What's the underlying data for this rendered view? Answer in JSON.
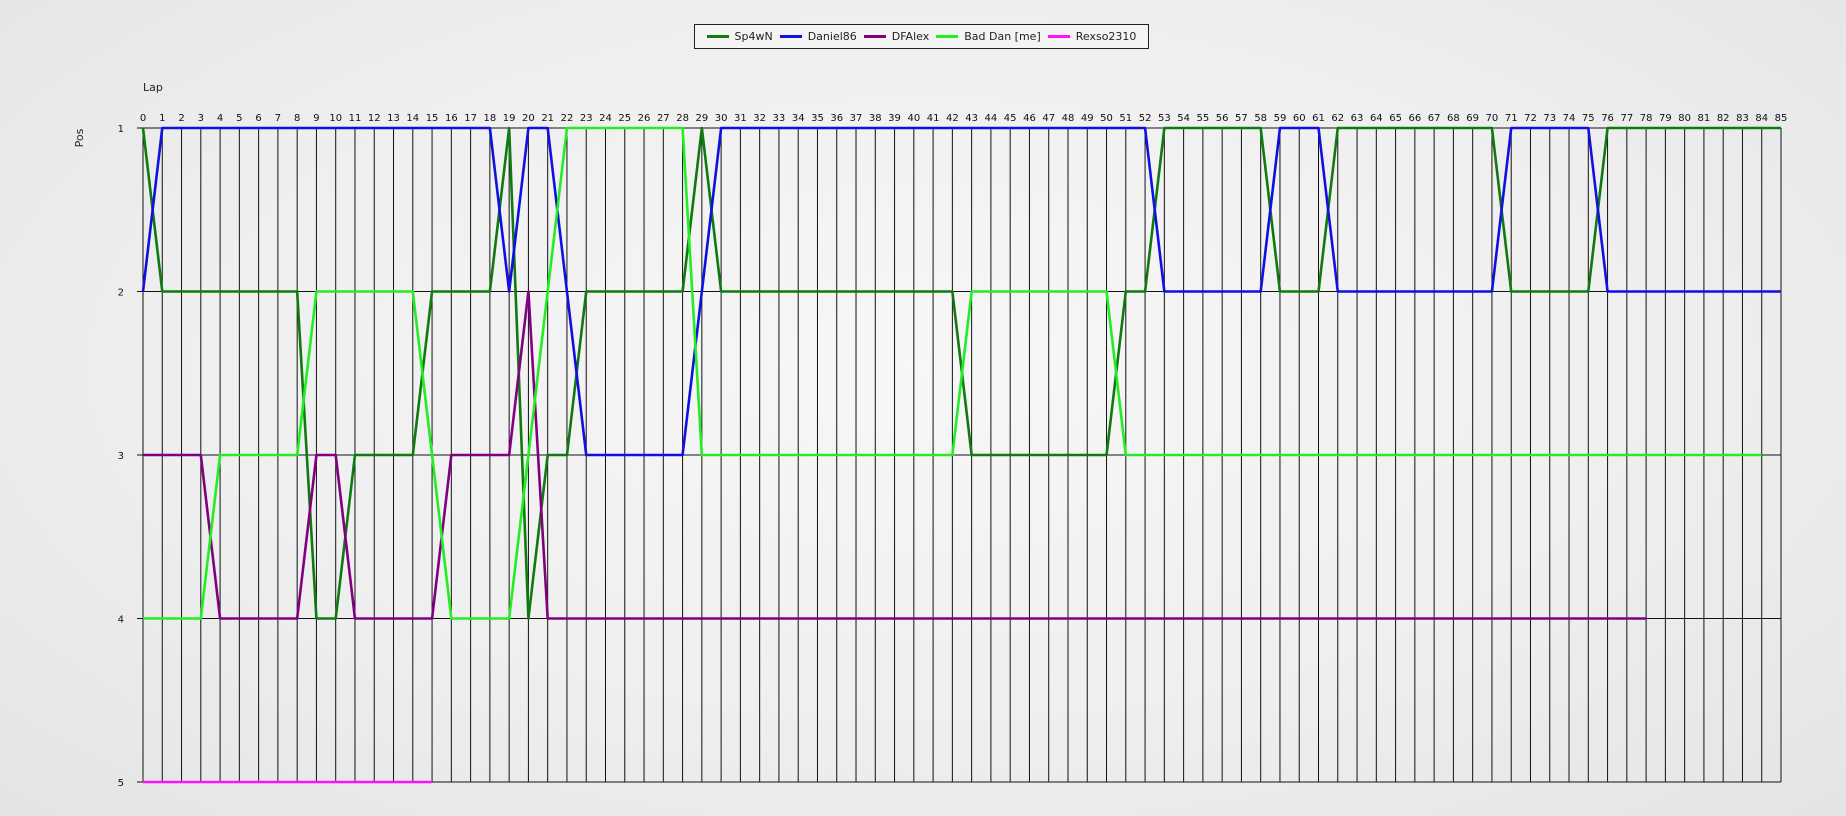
{
  "chart_data": {
    "type": "line",
    "xlabel": "Lap",
    "ylabel": "Pos",
    "xlim": [
      0,
      85
    ],
    "ylim": [
      1,
      5
    ],
    "y_inverted": true,
    "grid": true,
    "legend_position": "top-center",
    "x_ticks": [
      0,
      1,
      2,
      3,
      4,
      5,
      6,
      7,
      8,
      9,
      10,
      11,
      12,
      13,
      14,
      15,
      16,
      17,
      18,
      19,
      20,
      21,
      22,
      23,
      24,
      25,
      26,
      27,
      28,
      29,
      30,
      31,
      32,
      33,
      34,
      35,
      36,
      37,
      38,
      39,
      40,
      41,
      42,
      43,
      44,
      45,
      46,
      47,
      48,
      49,
      50,
      51,
      52,
      53,
      54,
      55,
      56,
      57,
      58,
      59,
      60,
      61,
      62,
      63,
      64,
      65,
      66,
      67,
      68,
      69,
      70,
      71,
      72,
      73,
      74,
      75,
      76,
      77,
      78,
      79,
      80,
      81,
      82,
      83,
      84,
      85
    ],
    "y_ticks": [
      1,
      2,
      3,
      4,
      5
    ],
    "series": [
      {
        "name": "Sp4wN",
        "color": "#0f7a0f",
        "points": [
          [
            0,
            1
          ],
          [
            1,
            2
          ],
          [
            8,
            2
          ],
          [
            9,
            4
          ],
          [
            10,
            4
          ],
          [
            11,
            3
          ],
          [
            14,
            3
          ],
          [
            15,
            2
          ],
          [
            18,
            2
          ],
          [
            19,
            1
          ],
          [
            20,
            4
          ],
          [
            21,
            3
          ],
          [
            22,
            3
          ],
          [
            23,
            2
          ],
          [
            28,
            2
          ],
          [
            29,
            1
          ],
          [
            30,
            2
          ],
          [
            42,
            2
          ],
          [
            43,
            3
          ],
          [
            50,
            3
          ],
          [
            51,
            2
          ],
          [
            52,
            2
          ],
          [
            53,
            1
          ],
          [
            58,
            1
          ],
          [
            59,
            2
          ],
          [
            61,
            2
          ],
          [
            62,
            1
          ],
          [
            70,
            1
          ],
          [
            71,
            2
          ],
          [
            75,
            2
          ],
          [
            76,
            1
          ],
          [
            85,
            1
          ]
        ]
      },
      {
        "name": "Daniel86",
        "color": "#1010e0",
        "points": [
          [
            0,
            2
          ],
          [
            1,
            1
          ],
          [
            18,
            1
          ],
          [
            19,
            2
          ],
          [
            20,
            1
          ],
          [
            21,
            1
          ],
          [
            23,
            3
          ],
          [
            28,
            3
          ],
          [
            30,
            1
          ],
          [
            52,
            1
          ],
          [
            53,
            2
          ],
          [
            58,
            2
          ],
          [
            59,
            1
          ],
          [
            61,
            1
          ],
          [
            62,
            2
          ],
          [
            70,
            2
          ],
          [
            71,
            1
          ],
          [
            75,
            1
          ],
          [
            76,
            2
          ],
          [
            85,
            2
          ]
        ]
      },
      {
        "name": "DFAlex",
        "color": "#800080",
        "points": [
          [
            0,
            3
          ],
          [
            3,
            3
          ],
          [
            4,
            4
          ],
          [
            8,
            4
          ],
          [
            9,
            3
          ],
          [
            10,
            3
          ],
          [
            11,
            4
          ],
          [
            15,
            4
          ],
          [
            16,
            3
          ],
          [
            19,
            3
          ],
          [
            20,
            2
          ],
          [
            21,
            4
          ],
          [
            78,
            4
          ]
        ]
      },
      {
        "name": "Bad Dan [me]",
        "color": "#22ee22",
        "points": [
          [
            0,
            4
          ],
          [
            3,
            4
          ],
          [
            4,
            3
          ],
          [
            8,
            3
          ],
          [
            9,
            2
          ],
          [
            14,
            2
          ],
          [
            15,
            3
          ],
          [
            16,
            4
          ],
          [
            19,
            4
          ],
          [
            22,
            1
          ],
          [
            28,
            1
          ],
          [
            29,
            3
          ],
          [
            42,
            3
          ],
          [
            43,
            2
          ],
          [
            50,
            2
          ],
          [
            51,
            3
          ],
          [
            84,
            3
          ]
        ]
      },
      {
        "name": "Rexso2310",
        "color": "#ff10ff",
        "points": [
          [
            0,
            5
          ],
          [
            15,
            5
          ]
        ]
      }
    ]
  }
}
